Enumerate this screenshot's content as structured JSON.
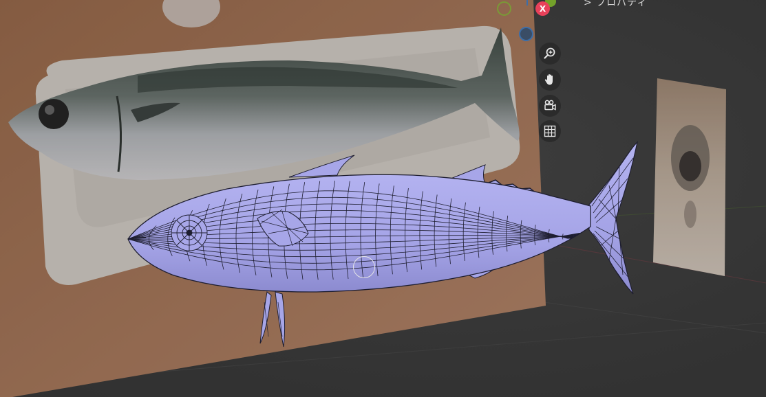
{
  "header": {
    "properties_label": "> プロパティ"
  },
  "gizmo": {
    "x_label": "X"
  },
  "colors": {
    "mesh_fill": "#a9a8ea",
    "mesh_wire": "#1e1e30",
    "axis_x": "#e8415a",
    "axis_y": "#73a12a",
    "axis_z": "#3c6ea8",
    "tray": "#d9d4cd",
    "table": "#b77c52"
  },
  "icons": [
    "zoom-icon",
    "pan-hand-icon",
    "camera-icon",
    "grid-icon"
  ]
}
